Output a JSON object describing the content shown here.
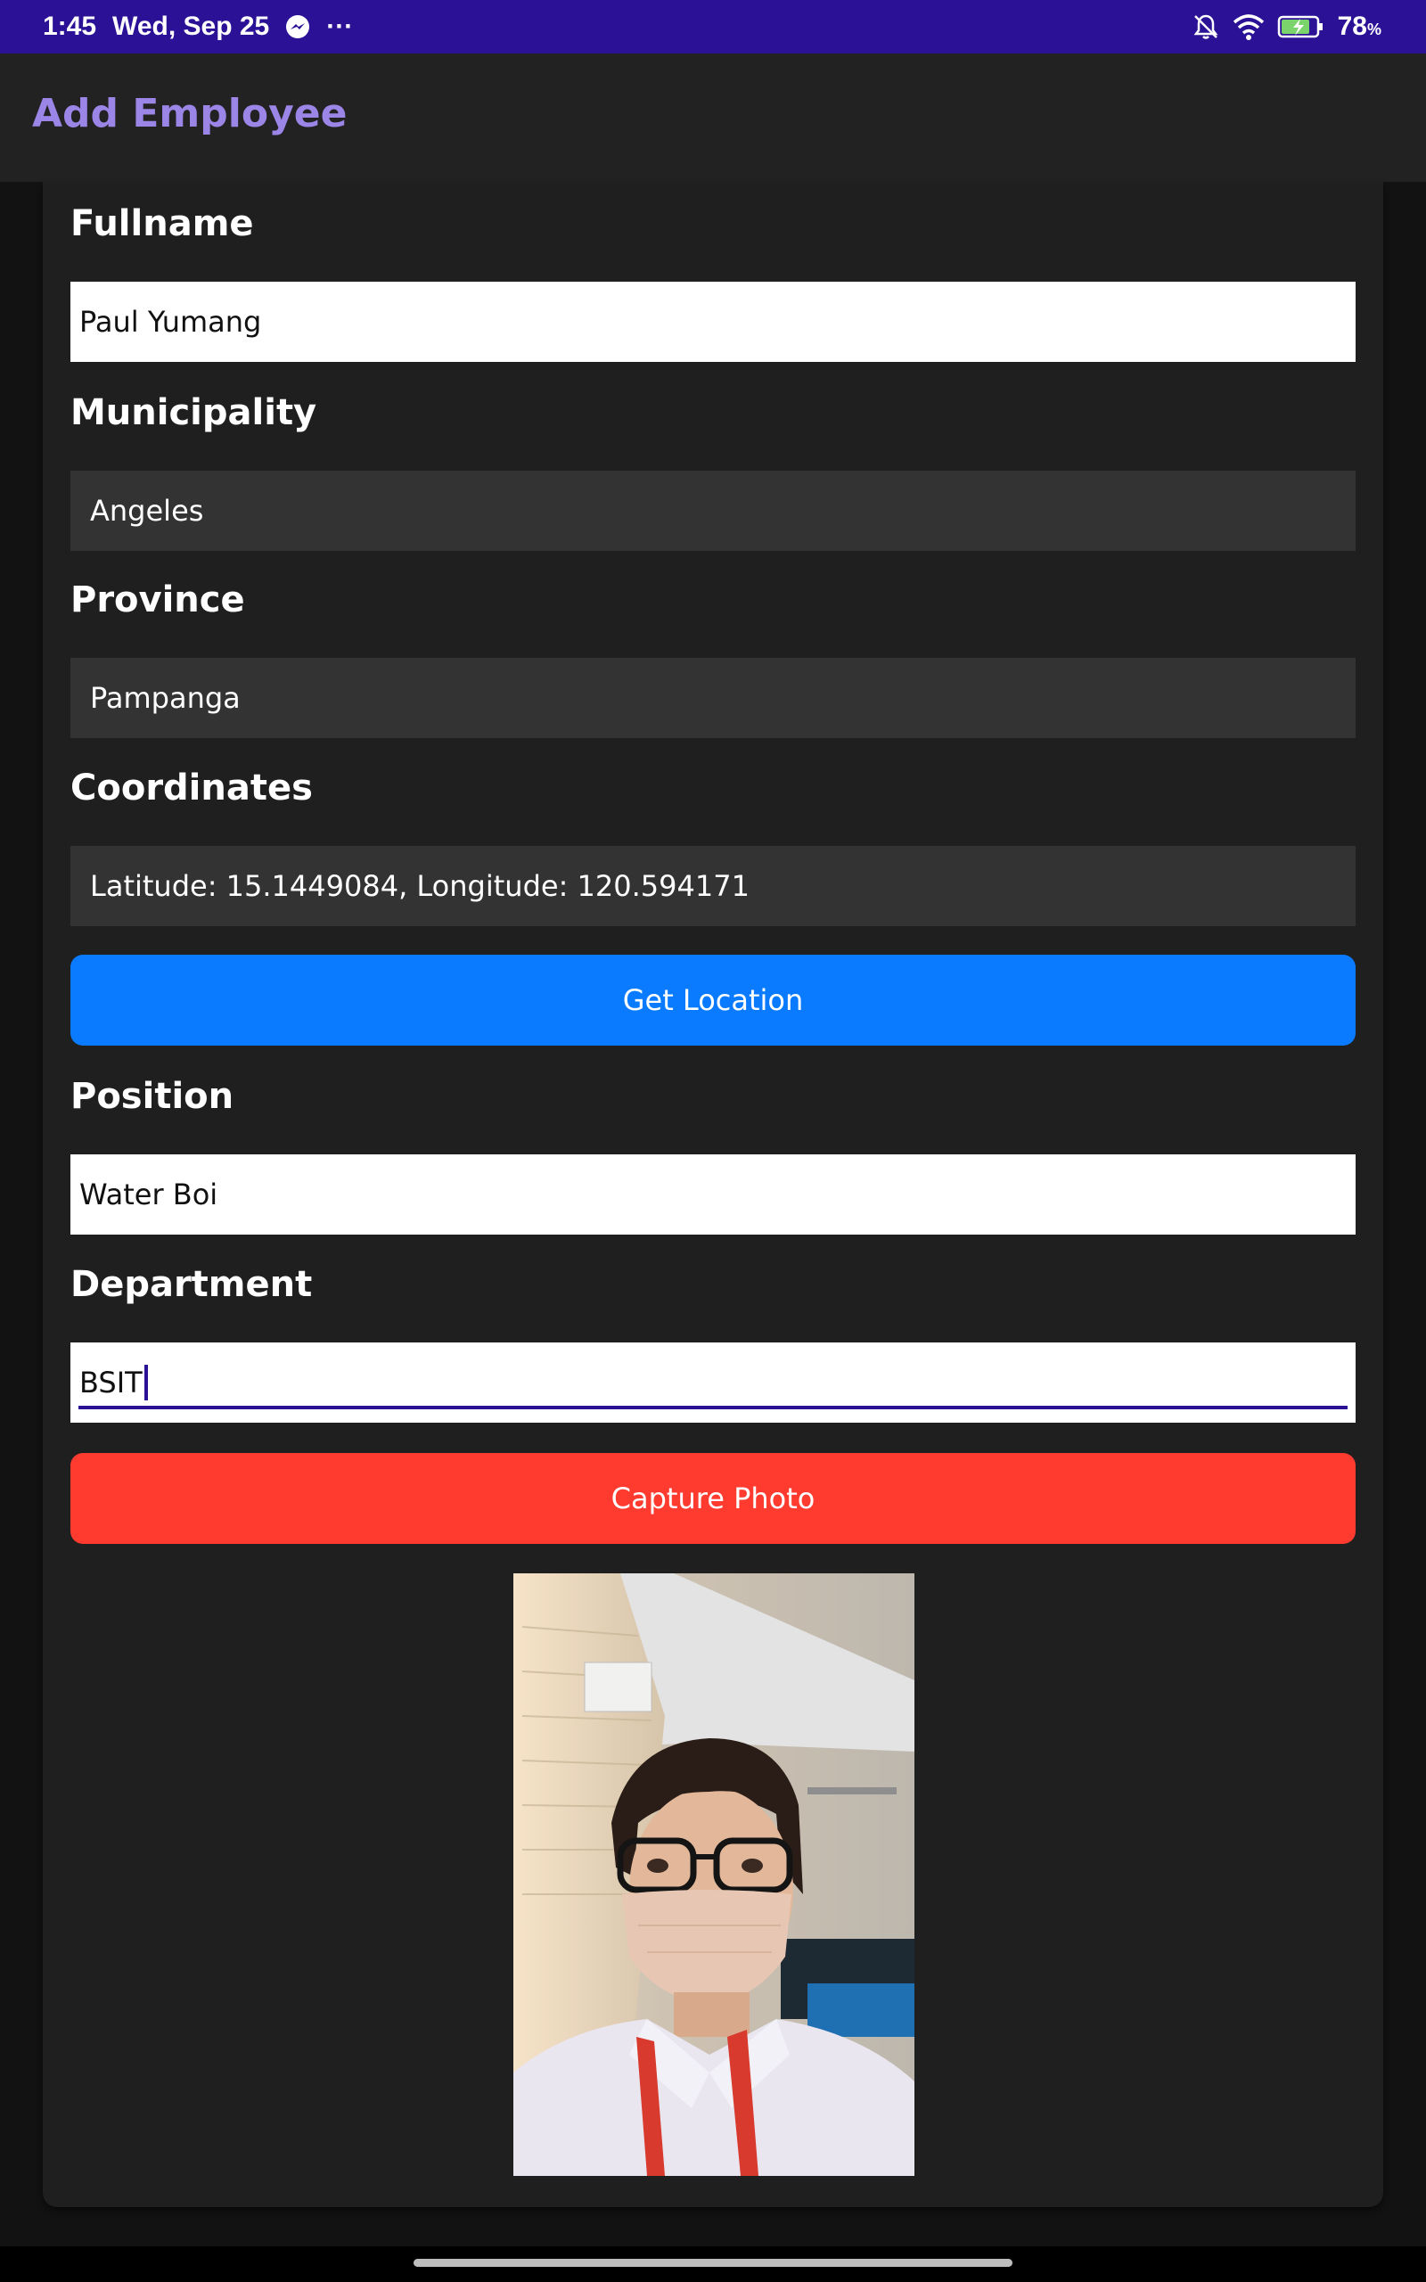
{
  "status_bar": {
    "time": "1:45",
    "date": "Wed, Sep 25",
    "more": "···",
    "battery": "78",
    "battery_unit": "%"
  },
  "app_bar": {
    "title": "Add Employee"
  },
  "form": {
    "fullname": {
      "label": "Fullname",
      "value": "Paul Yumang"
    },
    "municipality": {
      "label": "Municipality",
      "value": "Angeles"
    },
    "province": {
      "label": "Province",
      "value": "Pampanga"
    },
    "coordinates": {
      "label": "Coordinates",
      "value": "Latitude: 15.1449084, Longitude: 120.594171"
    },
    "get_location_button": "Get Location",
    "position": {
      "label": "Position",
      "value": "Water Boi"
    },
    "department": {
      "label": "Department",
      "value": "BSIT"
    },
    "capture_photo_button": "Capture Photo"
  },
  "colors": {
    "status_bar_bg": "#2a1196",
    "title_accent": "#9b85e6",
    "get_location_button": "#0a7bff",
    "capture_photo_button": "#ff3b30"
  }
}
